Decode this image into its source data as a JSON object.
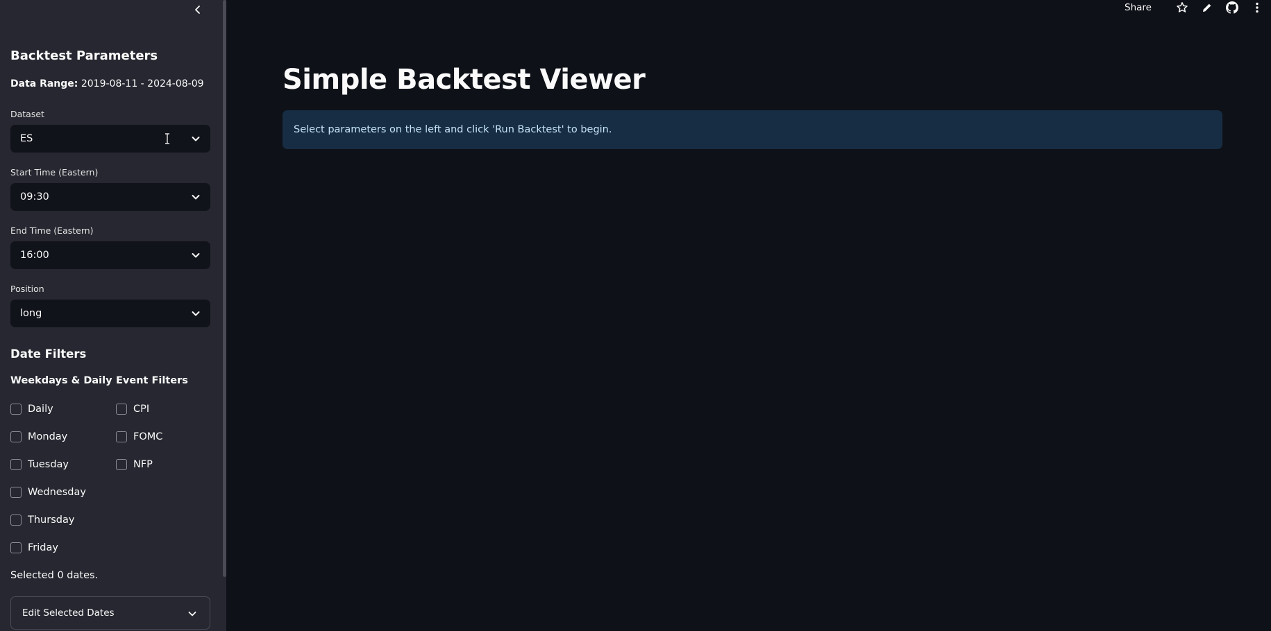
{
  "toolbar": {
    "share_label": "Share",
    "icons": [
      "star-icon",
      "pencil-icon",
      "github-icon",
      "more-vertical-icon"
    ]
  },
  "sidebar": {
    "title": "Backtest Parameters",
    "data_range_label": "Data Range:",
    "data_range_value": "2019-08-11 - 2024-08-09",
    "dataset": {
      "label": "Dataset",
      "value": "ES"
    },
    "start_time": {
      "label": "Start Time (Eastern)",
      "value": "09:30"
    },
    "end_time": {
      "label": "End Time (Eastern)",
      "value": "16:00"
    },
    "position": {
      "label": "Position",
      "value": "long"
    },
    "date_filters_title": "Date Filters",
    "weekdays_title": "Weekdays & Daily",
    "weekdays": [
      {
        "label": "Daily",
        "checked": false
      },
      {
        "label": "Monday",
        "checked": false
      },
      {
        "label": "Tuesday",
        "checked": false
      },
      {
        "label": "Wednesday",
        "checked": false
      },
      {
        "label": "Thursday",
        "checked": false
      },
      {
        "label": "Friday",
        "checked": false
      }
    ],
    "events_title": "Event Filters",
    "events": [
      {
        "label": "CPI",
        "checked": false
      },
      {
        "label": "FOMC",
        "checked": false
      },
      {
        "label": "NFP",
        "checked": false
      }
    ],
    "selected_text": "Selected 0 dates.",
    "expander_label": "Edit Selected Dates"
  },
  "main": {
    "title": "Simple Backtest Viewer",
    "info_message": "Select parameters on the left and click 'Run Backtest' to begin."
  },
  "colors": {
    "background": "#0e1117",
    "sidebar": "#262730",
    "select_bg": "#11131a",
    "info_bg": "#172d43",
    "info_text": "#c7e3f8"
  }
}
